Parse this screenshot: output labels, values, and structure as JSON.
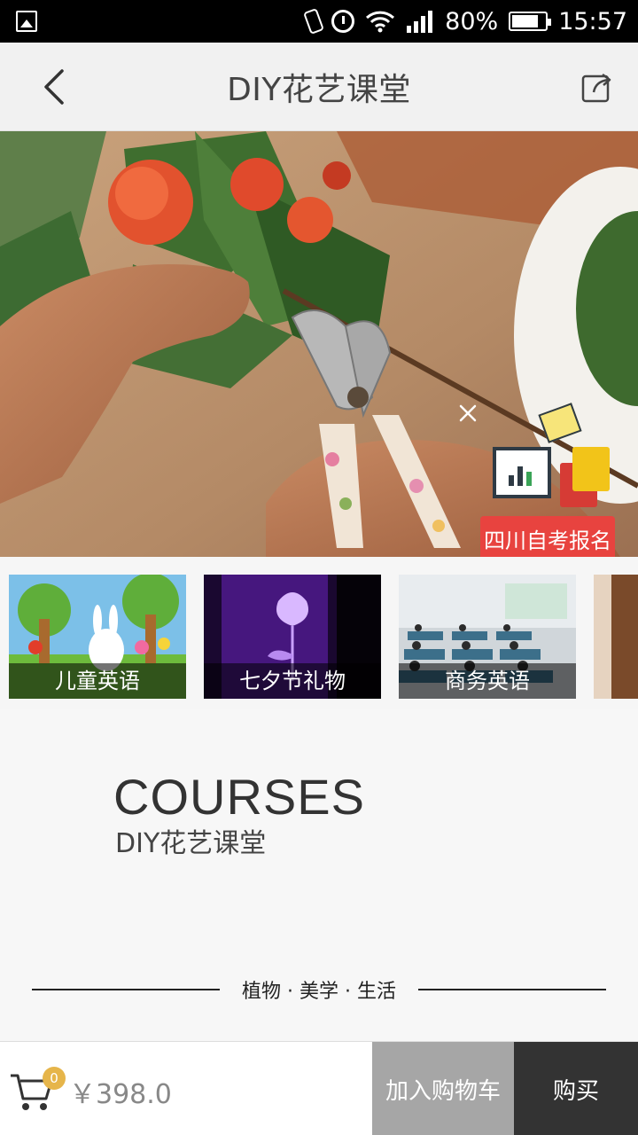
{
  "status_bar": {
    "battery": "80%",
    "battery_level": 0.8,
    "time": "15:57",
    "icons": [
      "gallery-icon",
      "vibrate-icon",
      "alarm-icon",
      "wifi-icon",
      "signal-icon",
      "battery-icon"
    ]
  },
  "header": {
    "title": "DIY花艺课堂",
    "back_icon": "chevron-left-icon",
    "share_icon": "share-icon"
  },
  "hero": {
    "image": "hands-pruning-flowers-photo",
    "ad": {
      "label": "四川自考报名",
      "close_icon": "close-icon"
    }
  },
  "categories": [
    {
      "label": "儿童英语"
    },
    {
      "label": "七夕节礼物"
    },
    {
      "label": "商务英语"
    }
  ],
  "courses": {
    "title": "COURSES",
    "subtitle": "DIY花艺课堂",
    "tagline": "植物 · 美学 · 生活"
  },
  "bottom_bar": {
    "cart_count": "0",
    "price": "￥398.0",
    "add_to_cart": "加入购物车",
    "buy": "购买"
  },
  "colors": {
    "ad_red": "#e8433f",
    "cart_badge": "#e6b54a",
    "add_cart_bg": "#a6a6a6",
    "buy_bg": "#333333"
  }
}
